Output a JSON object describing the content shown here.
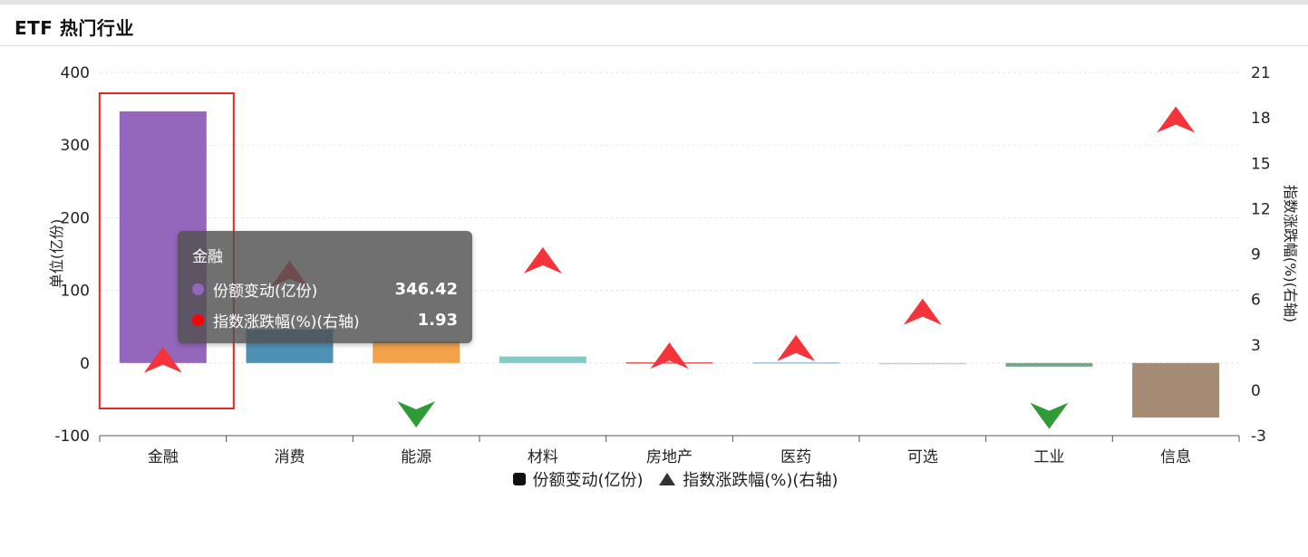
{
  "header": {
    "title": "ETF 热门行业"
  },
  "chart_data": {
    "type": "bar",
    "categories": [
      "金融",
      "消费",
      "能源",
      "材料",
      "房地产",
      "医药",
      "可选",
      "工业",
      "信息"
    ],
    "series": [
      {
        "name": "份额变动(亿份)",
        "type": "bar",
        "axis": "left",
        "values": [
          346.42,
          46,
          30,
          9,
          1,
          1,
          0,
          -5,
          -75
        ],
        "colors": [
          "#9467bd",
          "#4f91b6",
          "#f4a14a",
          "#82cbc8",
          "#e55a5a",
          "#a7bde0",
          "#cccccc",
          "#72a884",
          "#a58a74"
        ]
      },
      {
        "name": "指数涨跌幅(%)(右轴)",
        "type": "scatter",
        "axis": "right",
        "values": [
          1.93,
          7.6,
          -1.5,
          8.5,
          2.2,
          2.7,
          5.1,
          -1.6,
          17.8
        ],
        "up_color": "#f4333a",
        "down_color": "#2f9a36"
      }
    ],
    "ylabel": "单位(亿份)",
    "ylabel_right": "指数涨跌幅(%)(右轴)",
    "ylim": [
      -100,
      400
    ],
    "ylim_right": [
      -3,
      21
    ],
    "yticks": [
      "-100",
      "0",
      "100",
      "200",
      "300",
      "400"
    ],
    "yticks_right": [
      "-3",
      "0",
      "3",
      "6",
      "9",
      "12",
      "15",
      "18",
      "21"
    ],
    "yticks_values": [
      -100,
      0,
      100,
      200,
      300,
      400
    ],
    "yticks_right_values": [
      -3,
      0,
      3,
      6,
      9,
      12,
      15,
      18,
      21
    ],
    "grid": true,
    "legend_position": "bottom-center",
    "highlighted_category": "金融"
  },
  "tooltip": {
    "title": "金融",
    "rows": [
      {
        "label": "份额变动(亿份)",
        "value": "346.42",
        "color": "#9467bd"
      },
      {
        "label": "指数涨跌幅(%)(右轴)",
        "value": "1.93",
        "color": "#ff0000"
      }
    ]
  },
  "legend": [
    {
      "label": "份额变动(亿份)",
      "icon": "square-icon"
    },
    {
      "label": "指数涨跌幅(%)(右轴)",
      "icon": "triangle-icon"
    }
  ]
}
